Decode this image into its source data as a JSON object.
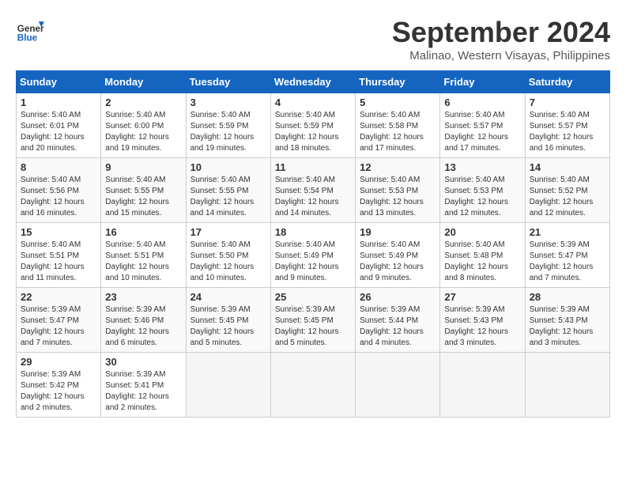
{
  "header": {
    "logo_general": "General",
    "logo_blue": "Blue",
    "month_year": "September 2024",
    "location": "Malinao, Western Visayas, Philippines"
  },
  "days_of_week": [
    "Sunday",
    "Monday",
    "Tuesday",
    "Wednesday",
    "Thursday",
    "Friday",
    "Saturday"
  ],
  "weeks": [
    [
      {
        "day": "1",
        "info": "Sunrise: 5:40 AM\nSunset: 6:01 PM\nDaylight: 12 hours\nand 20 minutes."
      },
      {
        "day": "2",
        "info": "Sunrise: 5:40 AM\nSunset: 6:00 PM\nDaylight: 12 hours\nand 19 minutes."
      },
      {
        "day": "3",
        "info": "Sunrise: 5:40 AM\nSunset: 5:59 PM\nDaylight: 12 hours\nand 19 minutes."
      },
      {
        "day": "4",
        "info": "Sunrise: 5:40 AM\nSunset: 5:59 PM\nDaylight: 12 hours\nand 18 minutes."
      },
      {
        "day": "5",
        "info": "Sunrise: 5:40 AM\nSunset: 5:58 PM\nDaylight: 12 hours\nand 17 minutes."
      },
      {
        "day": "6",
        "info": "Sunrise: 5:40 AM\nSunset: 5:57 PM\nDaylight: 12 hours\nand 17 minutes."
      },
      {
        "day": "7",
        "info": "Sunrise: 5:40 AM\nSunset: 5:57 PM\nDaylight: 12 hours\nand 16 minutes."
      }
    ],
    [
      {
        "day": "8",
        "info": "Sunrise: 5:40 AM\nSunset: 5:56 PM\nDaylight: 12 hours\nand 16 minutes."
      },
      {
        "day": "9",
        "info": "Sunrise: 5:40 AM\nSunset: 5:55 PM\nDaylight: 12 hours\nand 15 minutes."
      },
      {
        "day": "10",
        "info": "Sunrise: 5:40 AM\nSunset: 5:55 PM\nDaylight: 12 hours\nand 14 minutes."
      },
      {
        "day": "11",
        "info": "Sunrise: 5:40 AM\nSunset: 5:54 PM\nDaylight: 12 hours\nand 14 minutes."
      },
      {
        "day": "12",
        "info": "Sunrise: 5:40 AM\nSunset: 5:53 PM\nDaylight: 12 hours\nand 13 minutes."
      },
      {
        "day": "13",
        "info": "Sunrise: 5:40 AM\nSunset: 5:53 PM\nDaylight: 12 hours\nand 12 minutes."
      },
      {
        "day": "14",
        "info": "Sunrise: 5:40 AM\nSunset: 5:52 PM\nDaylight: 12 hours\nand 12 minutes."
      }
    ],
    [
      {
        "day": "15",
        "info": "Sunrise: 5:40 AM\nSunset: 5:51 PM\nDaylight: 12 hours\nand 11 minutes."
      },
      {
        "day": "16",
        "info": "Sunrise: 5:40 AM\nSunset: 5:51 PM\nDaylight: 12 hours\nand 10 minutes."
      },
      {
        "day": "17",
        "info": "Sunrise: 5:40 AM\nSunset: 5:50 PM\nDaylight: 12 hours\nand 10 minutes."
      },
      {
        "day": "18",
        "info": "Sunrise: 5:40 AM\nSunset: 5:49 PM\nDaylight: 12 hours\nand 9 minutes."
      },
      {
        "day": "19",
        "info": "Sunrise: 5:40 AM\nSunset: 5:49 PM\nDaylight: 12 hours\nand 9 minutes."
      },
      {
        "day": "20",
        "info": "Sunrise: 5:40 AM\nSunset: 5:48 PM\nDaylight: 12 hours\nand 8 minutes."
      },
      {
        "day": "21",
        "info": "Sunrise: 5:39 AM\nSunset: 5:47 PM\nDaylight: 12 hours\nand 7 minutes."
      }
    ],
    [
      {
        "day": "22",
        "info": "Sunrise: 5:39 AM\nSunset: 5:47 PM\nDaylight: 12 hours\nand 7 minutes."
      },
      {
        "day": "23",
        "info": "Sunrise: 5:39 AM\nSunset: 5:46 PM\nDaylight: 12 hours\nand 6 minutes."
      },
      {
        "day": "24",
        "info": "Sunrise: 5:39 AM\nSunset: 5:45 PM\nDaylight: 12 hours\nand 5 minutes."
      },
      {
        "day": "25",
        "info": "Sunrise: 5:39 AM\nSunset: 5:45 PM\nDaylight: 12 hours\nand 5 minutes."
      },
      {
        "day": "26",
        "info": "Sunrise: 5:39 AM\nSunset: 5:44 PM\nDaylight: 12 hours\nand 4 minutes."
      },
      {
        "day": "27",
        "info": "Sunrise: 5:39 AM\nSunset: 5:43 PM\nDaylight: 12 hours\nand 3 minutes."
      },
      {
        "day": "28",
        "info": "Sunrise: 5:39 AM\nSunset: 5:43 PM\nDaylight: 12 hours\nand 3 minutes."
      }
    ],
    [
      {
        "day": "29",
        "info": "Sunrise: 5:39 AM\nSunset: 5:42 PM\nDaylight: 12 hours\nand 2 minutes."
      },
      {
        "day": "30",
        "info": "Sunrise: 5:39 AM\nSunset: 5:41 PM\nDaylight: 12 hours\nand 2 minutes."
      },
      {
        "day": "",
        "info": ""
      },
      {
        "day": "",
        "info": ""
      },
      {
        "day": "",
        "info": ""
      },
      {
        "day": "",
        "info": ""
      },
      {
        "day": "",
        "info": ""
      }
    ]
  ]
}
